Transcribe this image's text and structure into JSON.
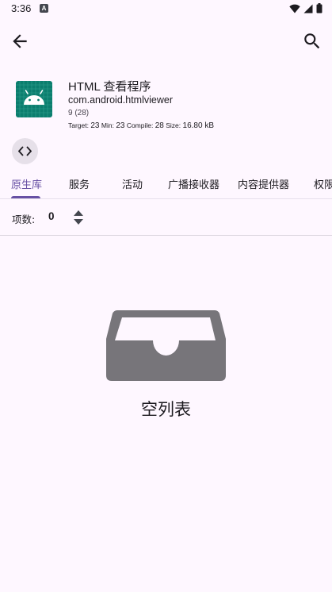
{
  "status_bar": {
    "time": "3:36",
    "notification_icon": "A",
    "icons": [
      "wifi-icon",
      "signal-icon",
      "battery-icon"
    ]
  },
  "app_bar": {
    "back_icon": "arrow-back-icon",
    "search_icon": "search-icon"
  },
  "app": {
    "name": "HTML 查看程序",
    "package": "com.android.htmlviewer",
    "version": "9 (28)",
    "meta": {
      "target_label": "Target:",
      "target_value": "23",
      "min_label": "Min:",
      "min_value": "23",
      "compile_label": "Compile:",
      "compile_value": "28",
      "size_label": "Size:",
      "size_value": "16.80 kB"
    },
    "icon": "android-icon",
    "icon_color": "#0B7E6E"
  },
  "code_chip_icon": "code-icon",
  "tabs": [
    {
      "label": "原生库",
      "active": true
    },
    {
      "label": "服务",
      "active": false
    },
    {
      "label": "活动",
      "active": false
    },
    {
      "label": "广播接收器",
      "active": false
    },
    {
      "label": "内容提供器",
      "active": false
    },
    {
      "label": "权限",
      "active": false
    }
  ],
  "list": {
    "count_label": "项数:",
    "count_value": "0",
    "sort_icon": "sort-icon"
  },
  "empty_state": {
    "icon": "inbox-icon",
    "text": "空列表"
  },
  "colors": {
    "background": "#FEF7FF",
    "accent": "#6750A4",
    "empty_icon": "#77757A"
  }
}
